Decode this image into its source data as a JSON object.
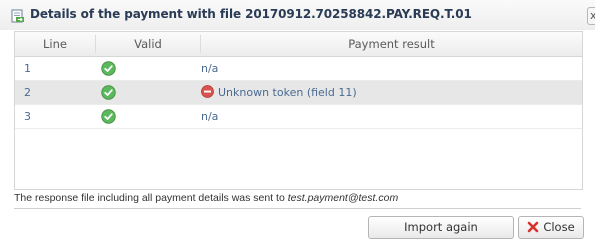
{
  "window": {
    "title": "Details of the payment with file 20170912.70258842.PAY.REQ.T.01",
    "close_glyph": "x"
  },
  "table": {
    "columns": [
      "Line",
      "Valid",
      "Payment result"
    ],
    "rows": [
      {
        "line": "1",
        "valid_icon": "check-circle-icon",
        "result": "n/a",
        "result_icon": null
      },
      {
        "line": "2",
        "valid_icon": "check-circle-icon",
        "result": "Unknown token (field 11)",
        "result_icon": "error-minus-icon"
      },
      {
        "line": "3",
        "valid_icon": "check-circle-icon",
        "result": "n/a",
        "result_icon": null
      }
    ]
  },
  "footer": {
    "message": "The response file including all payment details was sent to ",
    "email": "test.payment@test.com"
  },
  "buttons": {
    "import_again": "Import again",
    "close": "Close"
  },
  "colors": {
    "title_text": "#2a3b55",
    "cell_text": "#4a6a92",
    "check_green": "#5cb85c",
    "error_red": "#d9534f",
    "alt_row": "#e7e7e7"
  }
}
